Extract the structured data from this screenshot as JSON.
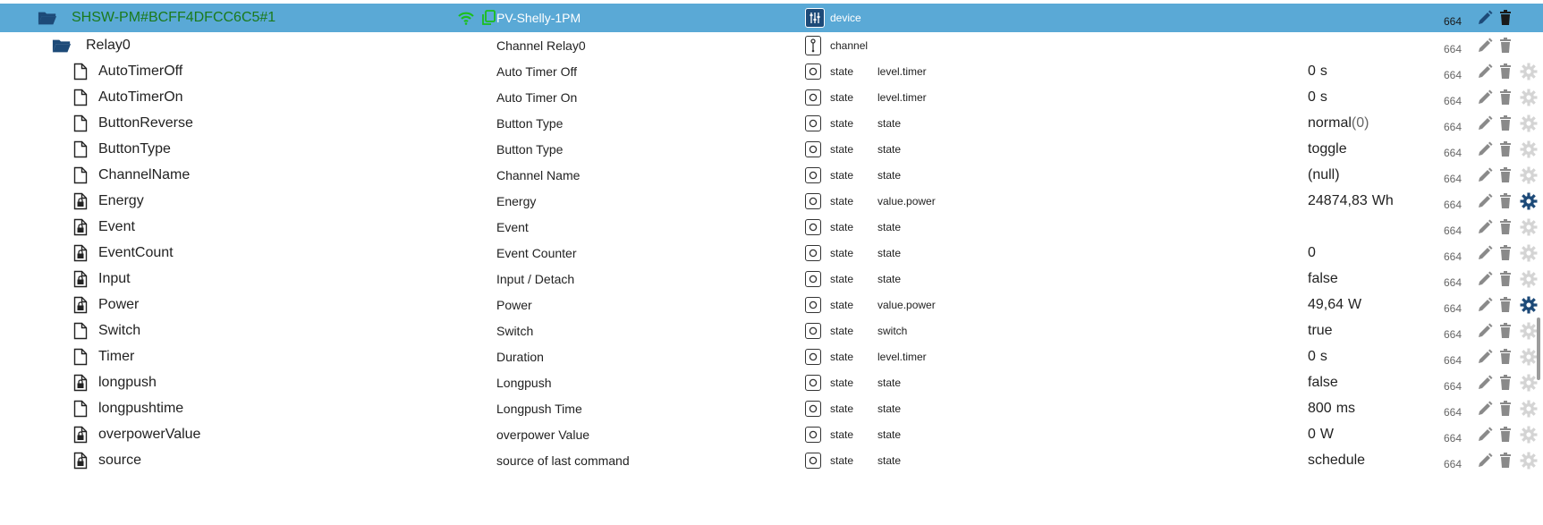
{
  "device": {
    "name": "SHSW-PM#BCFF4DFCC6C5#1",
    "description": "PV-Shelly-1PM",
    "type": "device",
    "acl": "664",
    "colors": {
      "selected_bg": "#5aa9d6",
      "name": "#1b7a1b",
      "wifi": "#1bbf1b"
    }
  },
  "channel": {
    "name": "Relay0",
    "description": "Channel Relay0",
    "type": "channel",
    "acl": "664"
  },
  "states": [
    {
      "name": "AutoTimerOff",
      "description": "Auto Timer Off",
      "type": "state",
      "role": "level.timer",
      "value": "0",
      "unit": "s",
      "extra": "",
      "locked": false,
      "acl": "664",
      "custom": false
    },
    {
      "name": "AutoTimerOn",
      "description": "Auto Timer On",
      "type": "state",
      "role": "level.timer",
      "value": "0",
      "unit": "s",
      "extra": "",
      "locked": false,
      "acl": "664",
      "custom": false
    },
    {
      "name": "ButtonReverse",
      "description": "Button Type",
      "type": "state",
      "role": "state",
      "value": "normal",
      "unit": "",
      "extra": "(0)",
      "locked": false,
      "acl": "664",
      "custom": false
    },
    {
      "name": "ButtonType",
      "description": "Button Type",
      "type": "state",
      "role": "state",
      "value": "toggle",
      "unit": "",
      "extra": "",
      "locked": false,
      "acl": "664",
      "custom": false
    },
    {
      "name": "ChannelName",
      "description": "Channel Name",
      "type": "state",
      "role": "state",
      "value": "(null)",
      "unit": "",
      "extra": "",
      "locked": false,
      "acl": "664",
      "custom": false
    },
    {
      "name": "Energy",
      "description": "Energy",
      "type": "state",
      "role": "value.power",
      "value": "24874,83",
      "unit": "Wh",
      "extra": "",
      "locked": true,
      "acl": "664",
      "custom": true
    },
    {
      "name": "Event",
      "description": "Event",
      "type": "state",
      "role": "state",
      "value": "",
      "unit": "",
      "extra": "",
      "locked": true,
      "acl": "664",
      "custom": false
    },
    {
      "name": "EventCount",
      "description": "Event Counter",
      "type": "state",
      "role": "state",
      "value": "0",
      "unit": "",
      "extra": "",
      "locked": true,
      "acl": "664",
      "custom": false
    },
    {
      "name": "Input",
      "description": "Input / Detach",
      "type": "state",
      "role": "state",
      "value": "false",
      "unit": "",
      "extra": "",
      "locked": true,
      "acl": "664",
      "custom": false
    },
    {
      "name": "Power",
      "description": "Power",
      "type": "state",
      "role": "value.power",
      "value": "49,64",
      "unit": "W",
      "extra": "",
      "locked": true,
      "acl": "664",
      "custom": true
    },
    {
      "name": "Switch",
      "description": "Switch",
      "type": "state",
      "role": "switch",
      "value": "true",
      "unit": "",
      "extra": "",
      "locked": false,
      "acl": "664",
      "custom": false
    },
    {
      "name": "Timer",
      "description": "Duration",
      "type": "state",
      "role": "level.timer",
      "value": "0",
      "unit": "s",
      "extra": "",
      "locked": false,
      "acl": "664",
      "custom": false
    },
    {
      "name": "longpush",
      "description": "Longpush",
      "type": "state",
      "role": "state",
      "value": "false",
      "unit": "",
      "extra": "",
      "locked": true,
      "acl": "664",
      "custom": false
    },
    {
      "name": "longpushtime",
      "description": "Longpush Time",
      "type": "state",
      "role": "state",
      "value": "800",
      "unit": "ms",
      "extra": "",
      "locked": false,
      "acl": "664",
      "custom": false
    },
    {
      "name": "overpowerValue",
      "description": "overpower Value",
      "type": "state",
      "role": "state",
      "value": "0",
      "unit": "W",
      "extra": "",
      "locked": true,
      "acl": "664",
      "custom": false
    },
    {
      "name": "source",
      "description": "source of last command",
      "type": "state",
      "role": "state",
      "value": "schedule",
      "unit": "",
      "extra": "",
      "locked": true,
      "acl": "664",
      "custom": false
    }
  ]
}
